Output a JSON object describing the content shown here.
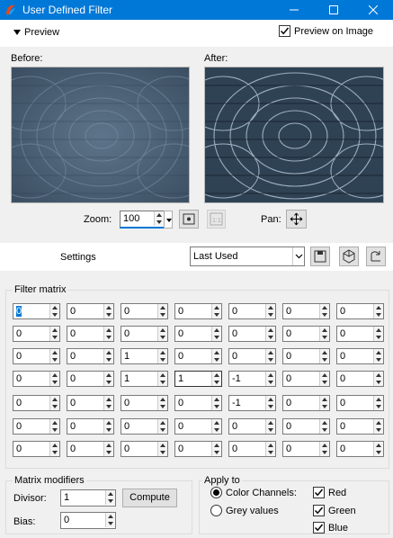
{
  "window": {
    "title": "User Defined Filter",
    "minimize_icon": "minimize-icon",
    "maximize_icon": "maximize-icon",
    "close_icon": "close-icon"
  },
  "preview": {
    "label": "Preview",
    "preview_on_image_label": "Preview on Image",
    "preview_on_image_checked": true
  },
  "panes": {
    "before_label": "Before:",
    "after_label": "After:"
  },
  "zoom": {
    "label": "Zoom:",
    "value": "100",
    "pan_label": "Pan:"
  },
  "settings": {
    "label": "Settings",
    "preset_value": "Last Used"
  },
  "matrix": {
    "title": "Filter matrix",
    "rows": [
      [
        "0",
        "0",
        "0",
        "0",
        "0",
        "0",
        "0"
      ],
      [
        "0",
        "0",
        "0",
        "0",
        "0",
        "0",
        "0"
      ],
      [
        "0",
        "0",
        "1",
        "0",
        "0",
        "0",
        "0"
      ],
      [
        "0",
        "0",
        "1",
        "1",
        "-1",
        "0",
        "0"
      ],
      [
        "0",
        "0",
        "0",
        "0",
        "-1",
        "0",
        "0"
      ],
      [
        "0",
        "0",
        "0",
        "0",
        "0",
        "0",
        "0"
      ],
      [
        "0",
        "0",
        "0",
        "0",
        "0",
        "0",
        "0"
      ]
    ]
  },
  "modifiers": {
    "title": "Matrix modifiers",
    "divisor_label": "Divisor:",
    "divisor_value": "1",
    "bias_label": "Bias:",
    "bias_value": "0",
    "compute_label": "Compute"
  },
  "apply_to": {
    "title": "Apply to",
    "color_channels_label": "Color Channels:",
    "grey_values_label": "Grey values",
    "color_channels_selected": true,
    "red_label": "Red",
    "green_label": "Green",
    "blue_label": "Blue",
    "red_checked": true,
    "green_checked": true,
    "blue_checked": true
  }
}
